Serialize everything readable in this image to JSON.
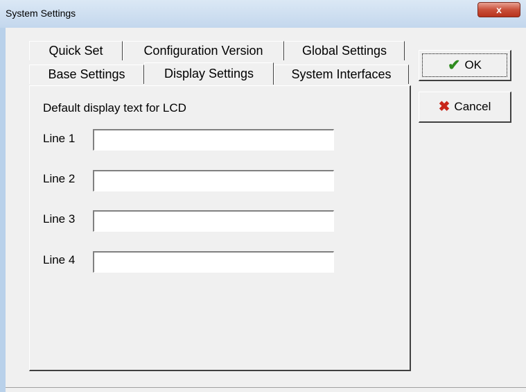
{
  "window": {
    "title": "System Settings",
    "close_label": "x"
  },
  "tabs": {
    "row_top": [
      {
        "label": "Quick Set"
      },
      {
        "label": "Configuration Version"
      },
      {
        "label": "Global Settings"
      }
    ],
    "row_bottom": [
      {
        "label": "Base Settings"
      },
      {
        "label": "Display Settings",
        "selected": true
      },
      {
        "label": "System Interfaces"
      }
    ]
  },
  "panel": {
    "heading": "Default display text for LCD",
    "lines": [
      {
        "label": "Line 1",
        "value": ""
      },
      {
        "label": "Line 2",
        "value": ""
      },
      {
        "label": "Line 3",
        "value": ""
      },
      {
        "label": "Line 4",
        "value": ""
      }
    ]
  },
  "buttons": {
    "ok_label": "OK",
    "ok_icon": "check-icon",
    "cancel_label": "Cancel",
    "cancel_icon": "x-icon"
  },
  "colors": {
    "check": "#2e8b1e",
    "cancel_x": "#c8261a",
    "close_button": "#c9503a"
  }
}
